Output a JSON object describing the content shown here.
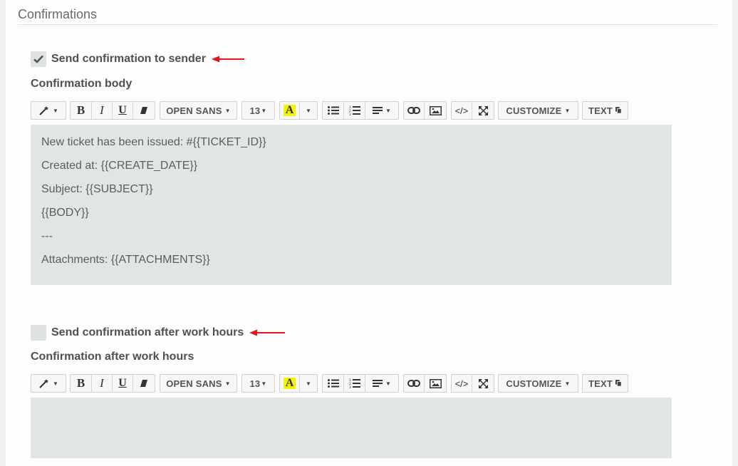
{
  "section": {
    "title": "Confirmations"
  },
  "block1": {
    "checkbox_label": "Send confirmation to sender",
    "checked": true,
    "field_label": "Confirmation body",
    "body_lines": [
      "New ticket has been issued: #{{TICKET_ID}}",
      "Created at: {{CREATE_DATE}}",
      "Subject: {{SUBJECT}}",
      "{{BODY}}",
      "---",
      "Attachments: {{ATTACHMENTS}}"
    ]
  },
  "block2": {
    "checkbox_label": "Send confirmation after work hours",
    "checked": false,
    "field_label": "Confirmation after work hours",
    "body_lines": []
  },
  "toolbar": {
    "font_family": "OPEN SANS",
    "font_size": "13",
    "customize": "CUSTOMIZE",
    "text": "TEXT",
    "bold": "B",
    "italic": "I",
    "underline": "U",
    "highlight": "A",
    "code": "</>"
  },
  "colors": {
    "arrow": "#e8121b",
    "editor_bg": "#e2e5e6",
    "highlight": "#f5f500"
  },
  "icons": [
    "magic-wand-icon",
    "eraser-icon",
    "unordered-list-icon",
    "ordered-list-icon",
    "align-icon",
    "link-icon",
    "image-icon",
    "fullscreen-icon",
    "copy-icon",
    "checkmark-icon",
    "red-arrow-icon"
  ]
}
